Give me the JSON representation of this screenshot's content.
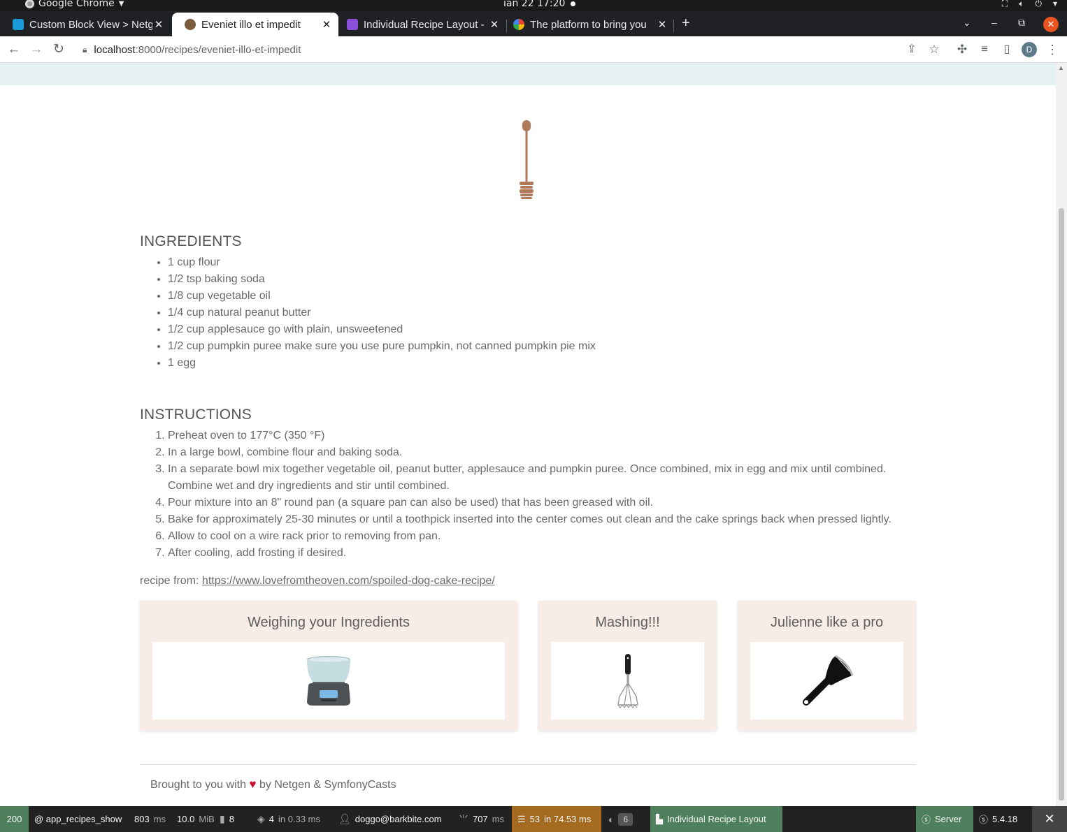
{
  "os": {
    "app_name": "Google Chrome",
    "clock": "ian 22  17:20"
  },
  "browser": {
    "tabs": [
      {
        "title": "Custom Block View > Netg",
        "favicon_color": "#1a9bd7"
      },
      {
        "title": "Eveniet illo et impedit",
        "favicon_color": "#7a5a3a"
      },
      {
        "title": "Individual Recipe Layout -",
        "favicon_color": "#8a4fd8"
      },
      {
        "title": "The platform to bring you",
        "favicon_color": "#ea4335"
      }
    ],
    "new_tab": "+",
    "url_host": "localhost",
    "url_rest": ":8000/recipes/eveniet-illo-et-impedit",
    "profile_initial": "D"
  },
  "recipe": {
    "ingredients_title": "INGREDIENTS",
    "ingredients": [
      "1 cup flour",
      "1/2 tsp baking soda",
      "1/8 cup vegetable oil",
      "1/4 cup natural peanut butter",
      "1/2 cup applesauce go with plain, unsweetened",
      "1/2 cup pumpkin puree make sure you use pure pumpkin, not canned pumpkin pie mix",
      "1 egg"
    ],
    "instructions_title": "INSTRUCTIONS",
    "instructions": [
      "Preheat oven to 177°C (350 °F)",
      "In a large bowl, combine flour and baking soda.",
      "In a separate bowl mix together vegetable oil, peanut butter, applesauce and pumpkin puree. Once combined, mix in egg and mix until combined. Combine wet and dry ingredients and stir until combined.",
      "Pour mixture into an 8\" round pan (a square pan can also be used) that has been greased with oil.",
      "Bake for approximately 25-30 minutes or until a toothpick inserted into the center comes out clean and the cake springs back when pressed lightly.",
      "Allow to cool on a wire rack prior to removing from pan.",
      "After cooling, add frosting if desired."
    ],
    "source_label": "recipe from: ",
    "source_url": "https://www.lovefromtheoven.com/spoiled-dog-cake-recipe/"
  },
  "cards": [
    {
      "title": "Weighing your Ingredients",
      "icon": "kitchen-scale-icon"
    },
    {
      "title": "Mashing!!!",
      "icon": "potato-masher-icon"
    },
    {
      "title": "Julienne like a pro",
      "icon": "peeler-icon"
    }
  ],
  "footer": {
    "prefix": "Brought to you with",
    "suffix": "by Netgen & SymfonyCasts"
  },
  "debug_toolbar": {
    "status": "200",
    "route": "@ app_recipes_show",
    "time": "803",
    "time_unit": "ms",
    "memory": "10.0",
    "memory_unit": "MiB",
    "logs": "8",
    "cache": "4",
    "cache_detail": "in 0.33 ms",
    "user": "doggo@barkbite.com",
    "render": "707",
    "render_unit": "ms",
    "db": "53",
    "db_detail": "in 74.53 ms",
    "layouts_count": "6",
    "layout_name": "Individual Recipe Layout",
    "server": "Server",
    "version": "5.4.18"
  },
  "colors": {
    "header_band": "#e6f1f1",
    "card_bg": "#f8ece7",
    "status_ok": "#4f805d",
    "db_warning": "#a46a1f",
    "layout_green": "#4f805d",
    "heart": "#c8102e"
  }
}
